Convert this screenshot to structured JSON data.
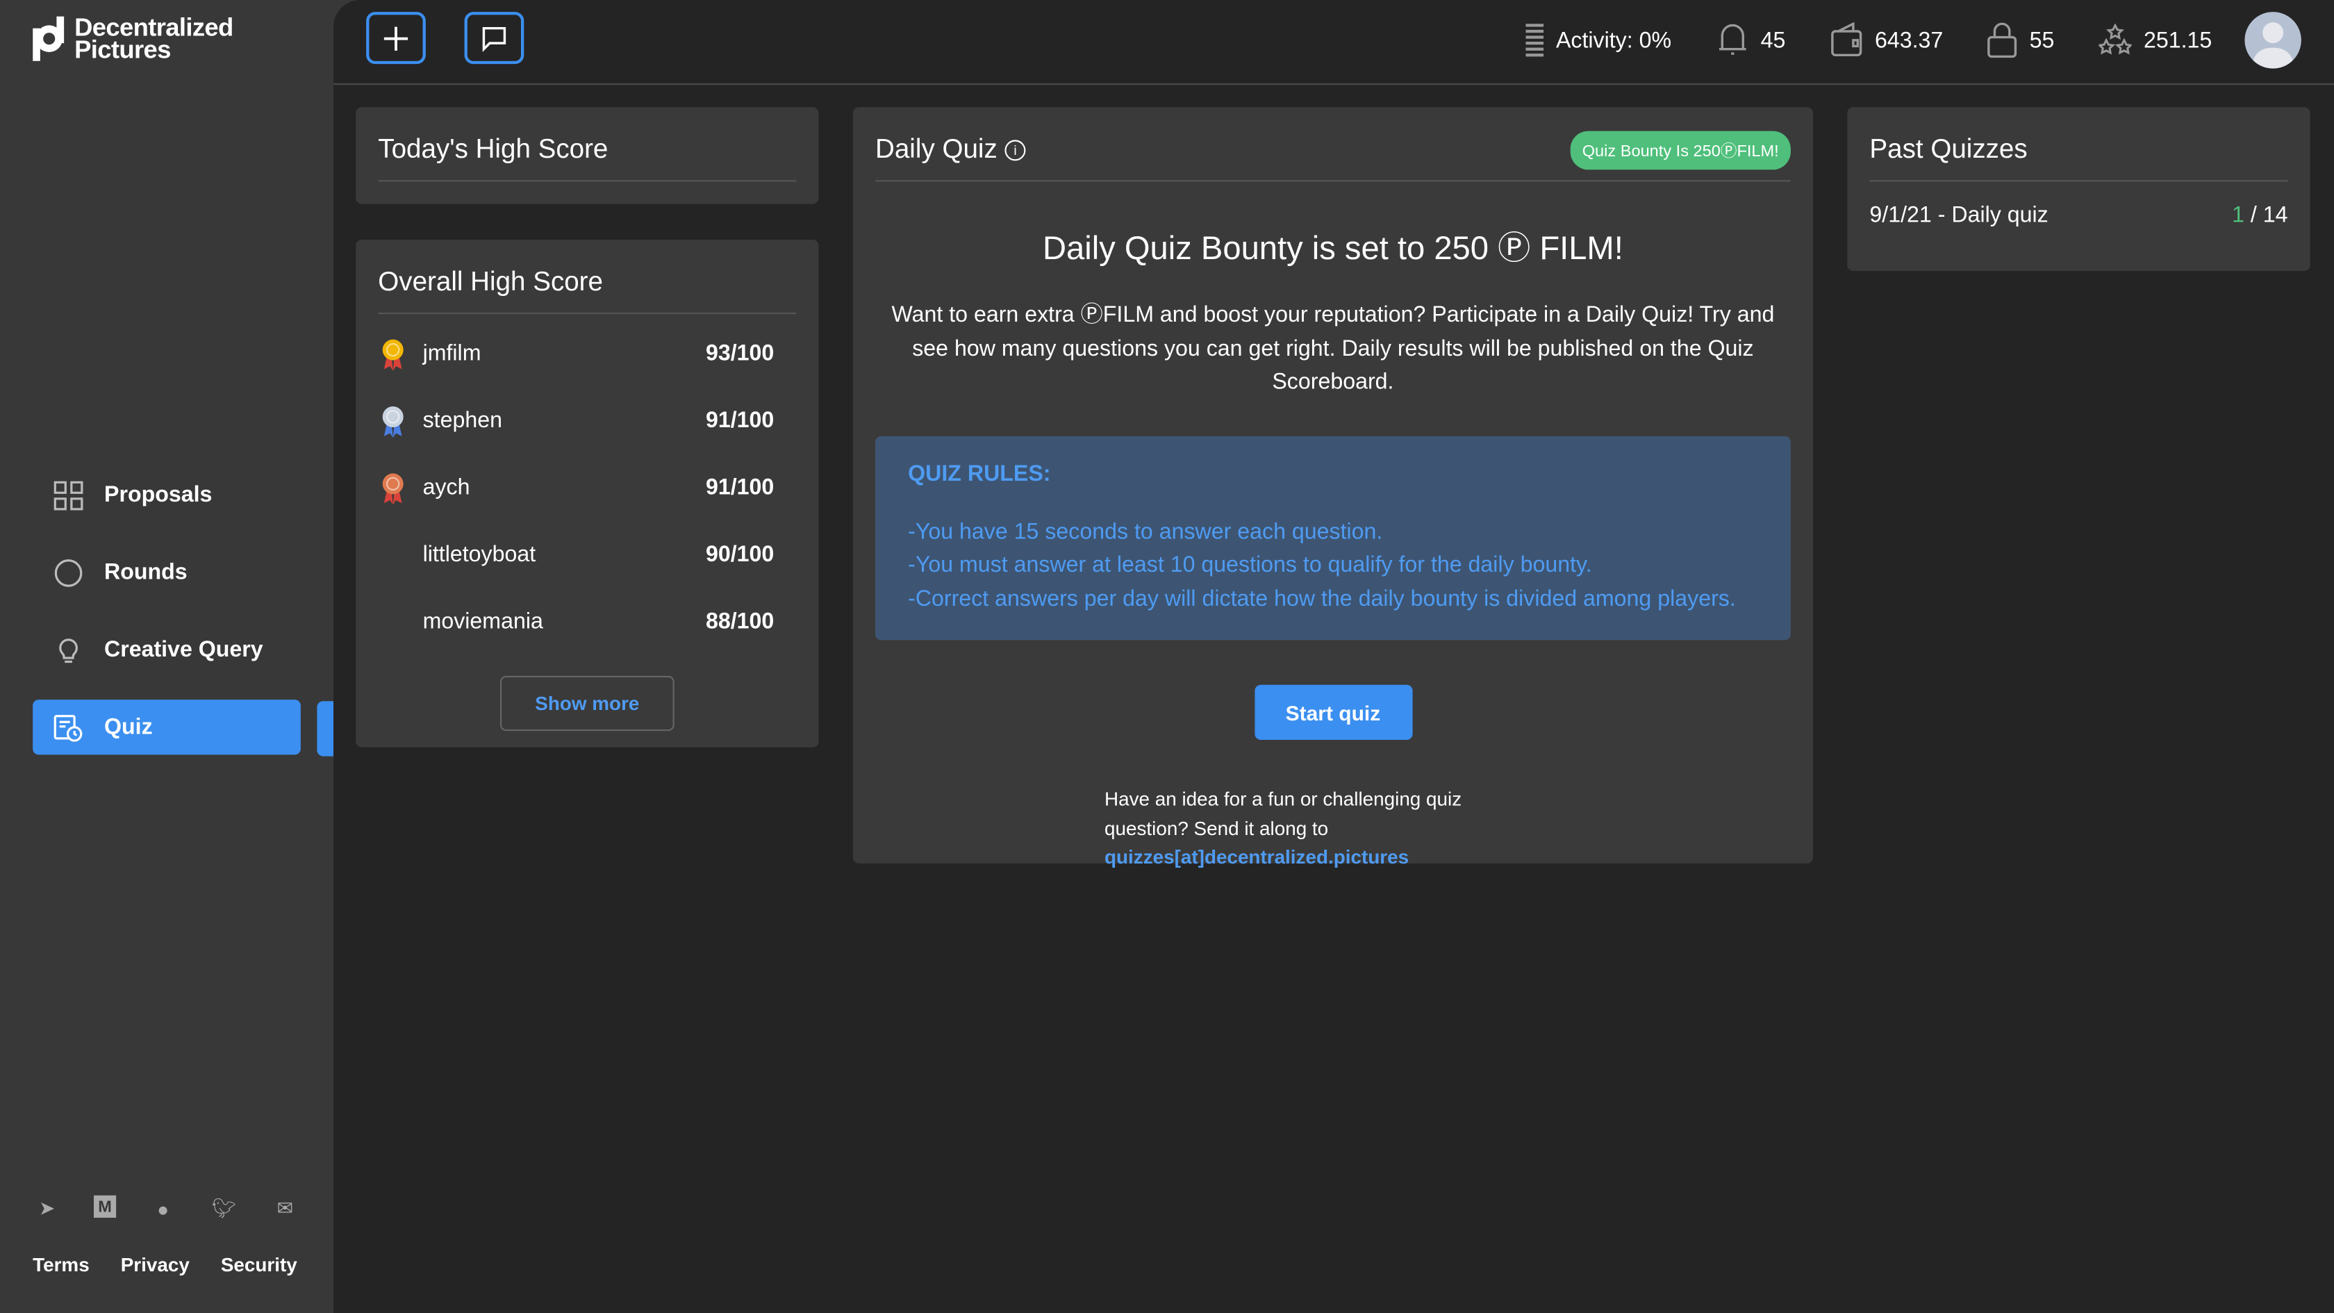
{
  "brand": {
    "line1": "Decentralized",
    "line2": "Pictures"
  },
  "sidebar": {
    "items": [
      {
        "label": "Proposals",
        "icon": "grid-icon"
      },
      {
        "label": "Rounds",
        "icon": "circle-icon"
      },
      {
        "label": "Creative Query",
        "icon": "lightbulb-icon"
      },
      {
        "label": "Quiz",
        "icon": "quiz-icon",
        "active": true
      }
    ],
    "social": [
      "telegram-icon",
      "medium-icon",
      "github-icon",
      "twitter-icon",
      "mail-icon"
    ],
    "footer": [
      "Terms",
      "Privacy",
      "Security"
    ]
  },
  "topbar": {
    "activity": "Activity: 0%",
    "notifications": "45",
    "wallet": "643.37",
    "locked": "55",
    "reputation": "251.15"
  },
  "todays_high_score": {
    "title": "Today's High Score"
  },
  "overall_high_score": {
    "title": "Overall High Score",
    "rows": [
      {
        "name": "jmfilm",
        "score": "93/100",
        "medal": "gold"
      },
      {
        "name": "stephen",
        "score": "91/100",
        "medal": "silver"
      },
      {
        "name": "aych",
        "score": "91/100",
        "medal": "bronze"
      },
      {
        "name": "littletoyboat",
        "score": "90/100"
      },
      {
        "name": "moviemania",
        "score": "88/100"
      }
    ],
    "show_more": "Show more"
  },
  "daily_quiz": {
    "title": "Daily Quiz",
    "badge": "Quiz Bounty Is 250ⓅFILM!",
    "headline": "Daily Quiz Bounty is set to 250 Ⓟ FILM!",
    "description": "Want to earn extra ⓅFILM and boost your reputation? Participate in a Daily Quiz! Try and see how many questions you can get right. Daily results will be published on the Quiz Scoreboard.",
    "rules_title": "QUIZ RULES:",
    "rules": [
      "-You have 15 seconds to answer each question.",
      "-You must answer at least 10 questions to qualify for the daily bounty.",
      "-Correct answers per day will dictate how the daily bounty is divided among players."
    ],
    "start": "Start quiz",
    "idea": "Have an idea for a fun or challenging quiz question? Send it along to",
    "email": "quizzes[at]decentralized.pictures"
  },
  "past_quizzes": {
    "title": "Past Quizzes",
    "rows": [
      {
        "label": "9/1/21 - Daily quiz",
        "correct": "1",
        "total": "/ 14"
      }
    ]
  },
  "colors": {
    "accent": "#3b8ff0",
    "badge": "#4fbf7b",
    "rules_bg": "#3d5573"
  }
}
